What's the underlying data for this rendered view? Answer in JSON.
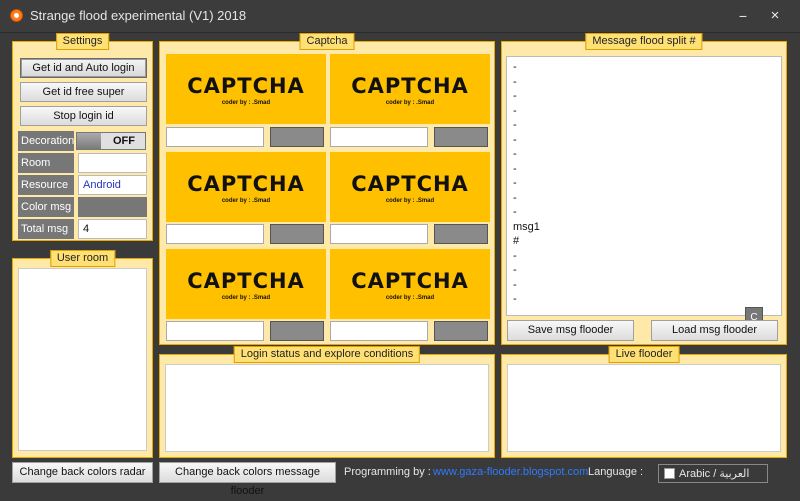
{
  "window": {
    "title": "Strange flood experimental (V1) 2018",
    "minimize_symbol": "−",
    "close_symbol": "×"
  },
  "settings": {
    "title": "Settings",
    "btn_get_auto": "Get id and Auto login",
    "btn_get_free": "Get id free super",
    "btn_stop": "Stop login  id",
    "decoration_label": "Decoration",
    "decoration_state": "OFF",
    "room_label": "Room",
    "room_value": "",
    "resource_label": "Resource",
    "resource_value": "Android",
    "color_label": "Color msg",
    "total_label": "Total msg",
    "total_value": "4"
  },
  "user_room": {
    "title": "User room"
  },
  "captcha": {
    "title": "Captcha",
    "word": "CAPTCHA",
    "sub": "coder by : .Smad"
  },
  "message_flood": {
    "title": "Message flood split #",
    "lines": [
      "-",
      "-",
      "-",
      "-",
      "-",
      "-",
      "-",
      "-",
      "-",
      "-",
      "-",
      "msg1",
      "#",
      "-",
      "-",
      "-",
      "-"
    ],
    "c_button": "C",
    "save_btn": "Save msg flooder",
    "load_btn": "Load msg flooder"
  },
  "login_status": {
    "title": "Login status and explore conditions"
  },
  "live_flooder": {
    "title": "Live flooder"
  },
  "bottom": {
    "btn_radar": "Change back colors radar",
    "btn_msg_flooder": "Change back colors message flooder",
    "programming_label": "Programming by :",
    "programming_link": "www.gaza-flooder.blogspot.com",
    "language_label": "Language :",
    "language_option": "Arabic / العربية"
  },
  "colors": {
    "panel_bg": "#ffe9a8",
    "panel_border": "#e8a800",
    "captcha_bg": "#ffc000",
    "window_bg": "#3a3a3a",
    "link": "#2f7bff"
  }
}
